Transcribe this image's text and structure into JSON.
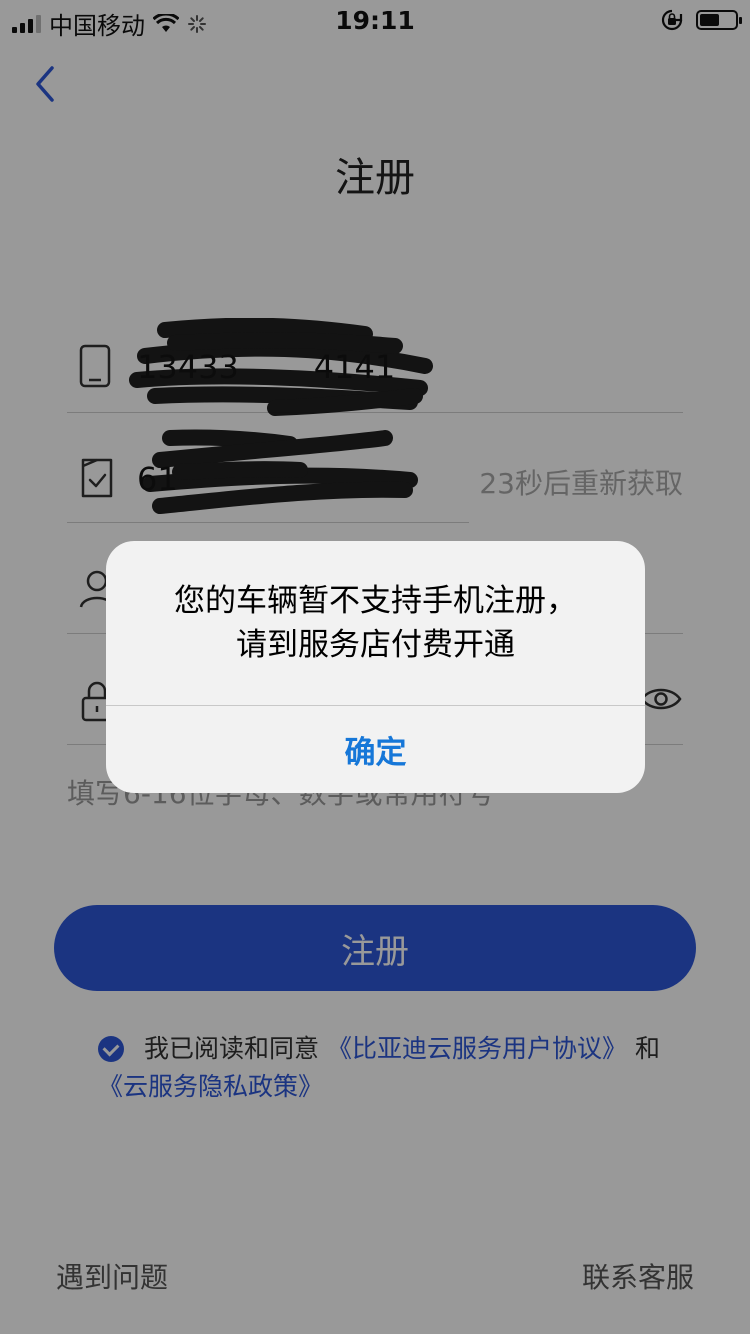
{
  "status_bar": {
    "carrier": "中国移动",
    "time": "19:11",
    "battery_level": 0.55
  },
  "header": {
    "title": "注册"
  },
  "form": {
    "phone_value": "13433",
    "phone_value_tail": "4141",
    "code_value": "61",
    "resend_label": "23秒后重新获取",
    "hint": "填写6-16位字母、数字或常用符号"
  },
  "register_button": {
    "label": "注册"
  },
  "agreement": {
    "prefix": "我已阅读和同意",
    "link1": "《比亚迪云服务用户协议》",
    "connector": "和",
    "link2": "《云服务隐私政策》"
  },
  "footer": {
    "problem": "遇到问题",
    "contact": "联系客服"
  },
  "alert": {
    "message_line1": "您的车辆暂不支持手机注册，",
    "message_line2": "请到服务店付费开通",
    "confirm": "确定"
  },
  "colors": {
    "accent": "#2e58d8",
    "alert_button": "#1677d8"
  }
}
